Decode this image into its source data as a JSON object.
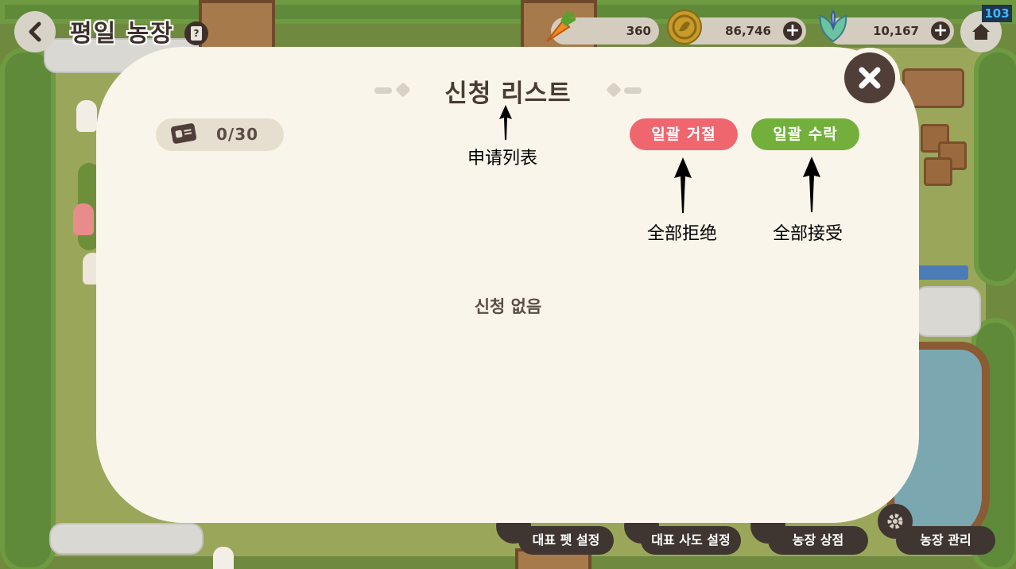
{
  "hud": {
    "title": "평일 농장",
    "help_label": "?",
    "fps": "103",
    "resources": [
      {
        "icon": "carrot-icon",
        "value": "360"
      },
      {
        "icon": "coin-icon",
        "value": "86,746"
      },
      {
        "icon": "leaf-gem-icon",
        "value": "10,167"
      }
    ],
    "plus_label": "+"
  },
  "modal": {
    "title": "신청 리스트",
    "counter": "0/30",
    "reject_all": "일괄 거절",
    "accept_all": "일괄 수락",
    "empty_text": "신청 없음"
  },
  "annotations": {
    "title": "申请列表",
    "reject_all": "全部拒绝",
    "accept_all": "全部接受"
  },
  "bottom_menu": [
    {
      "label": "대표 펫 설정"
    },
    {
      "label": "대표 사도 설정"
    },
    {
      "label": "농장 상점"
    },
    {
      "label": "농장 관리"
    }
  ],
  "colors": {
    "reject": "#f0666e",
    "accept": "#72b03b",
    "panel": "#faf5ea",
    "dark": "#4f3f38"
  }
}
